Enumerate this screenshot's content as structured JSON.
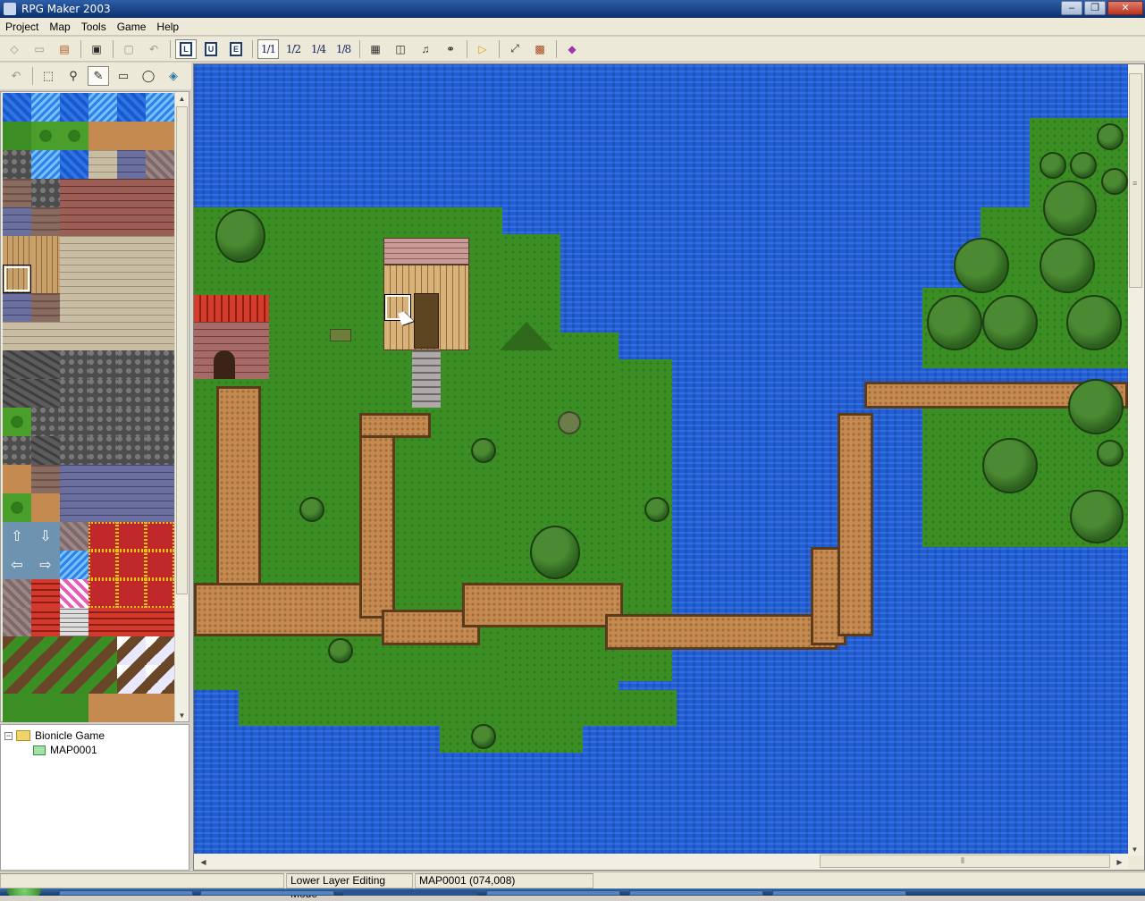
{
  "window": {
    "title": "RPG Maker 2003"
  },
  "menubar": {
    "items": [
      "Project",
      "Map",
      "Tools",
      "Game",
      "Help"
    ]
  },
  "toolbar": {
    "zoom_1_1": "1/1",
    "zoom_1_2": "1/2",
    "zoom_1_4": "1/4",
    "zoom_1_8": "1/8"
  },
  "project_tree": {
    "root": "Bionicle Game",
    "maps": [
      "MAP0001"
    ]
  },
  "status": {
    "mode": "Lower Layer Editing Mode",
    "position": "MAP0001 (074,008)"
  },
  "colors": {
    "water": "#1f5ed6",
    "grass": "#3b8e24",
    "dirt": "#c48a50",
    "titlebar": "#0c2f6d"
  },
  "icons": [
    "undo-icon",
    "pencil-icon",
    "rectangle-icon",
    "circle-icon",
    "fill-icon",
    "select-icon",
    "zoom-icon",
    "play-icon",
    "fullscreen-icon",
    "music-icon",
    "search-icon",
    "database-icon"
  ]
}
